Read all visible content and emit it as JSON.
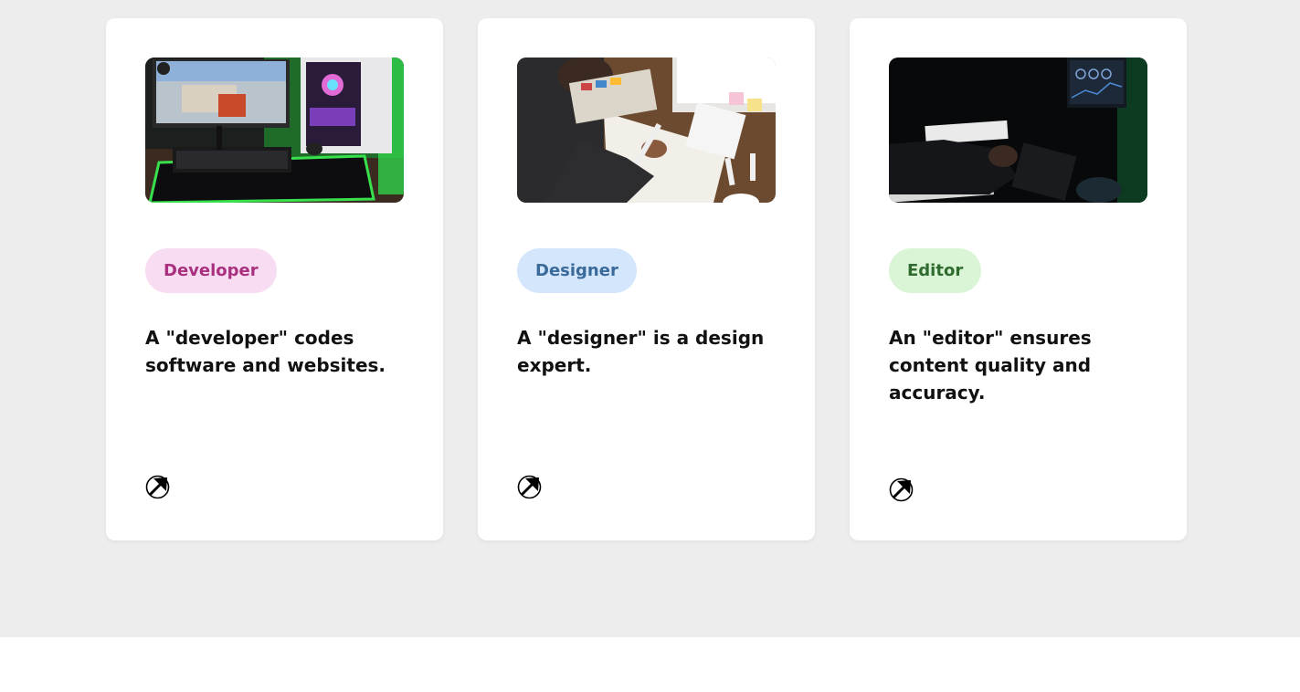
{
  "cards": [
    {
      "tag": "Developer",
      "description": "A \"developer\" codes software and websites.",
      "image": "gaming-pc-desk-photo",
      "link_icon": "arrow-up-right-circle-icon"
    },
    {
      "tag": "Designer",
      "description": "A \"designer\" is a design expert.",
      "image": "designer-sketching-photo",
      "link_icon": "arrow-up-right-circle-icon"
    },
    {
      "tag": "Editor",
      "description": "An \"editor\" ensures content quality and accuracy.",
      "image": "editor-at-dark-desk-photo",
      "link_icon": "arrow-up-right-circle-icon"
    }
  ],
  "colors": {
    "section_background": "#ededed",
    "card_background": "#ffffff",
    "developer_tag_bg": "#f8dcf2",
    "developer_tag_text": "#a8307e",
    "designer_tag_bg": "#d4e6fb",
    "designer_tag_text": "#3a6a9a",
    "editor_tag_bg": "#d9f5d6",
    "editor_tag_text": "#2f6a2e"
  }
}
